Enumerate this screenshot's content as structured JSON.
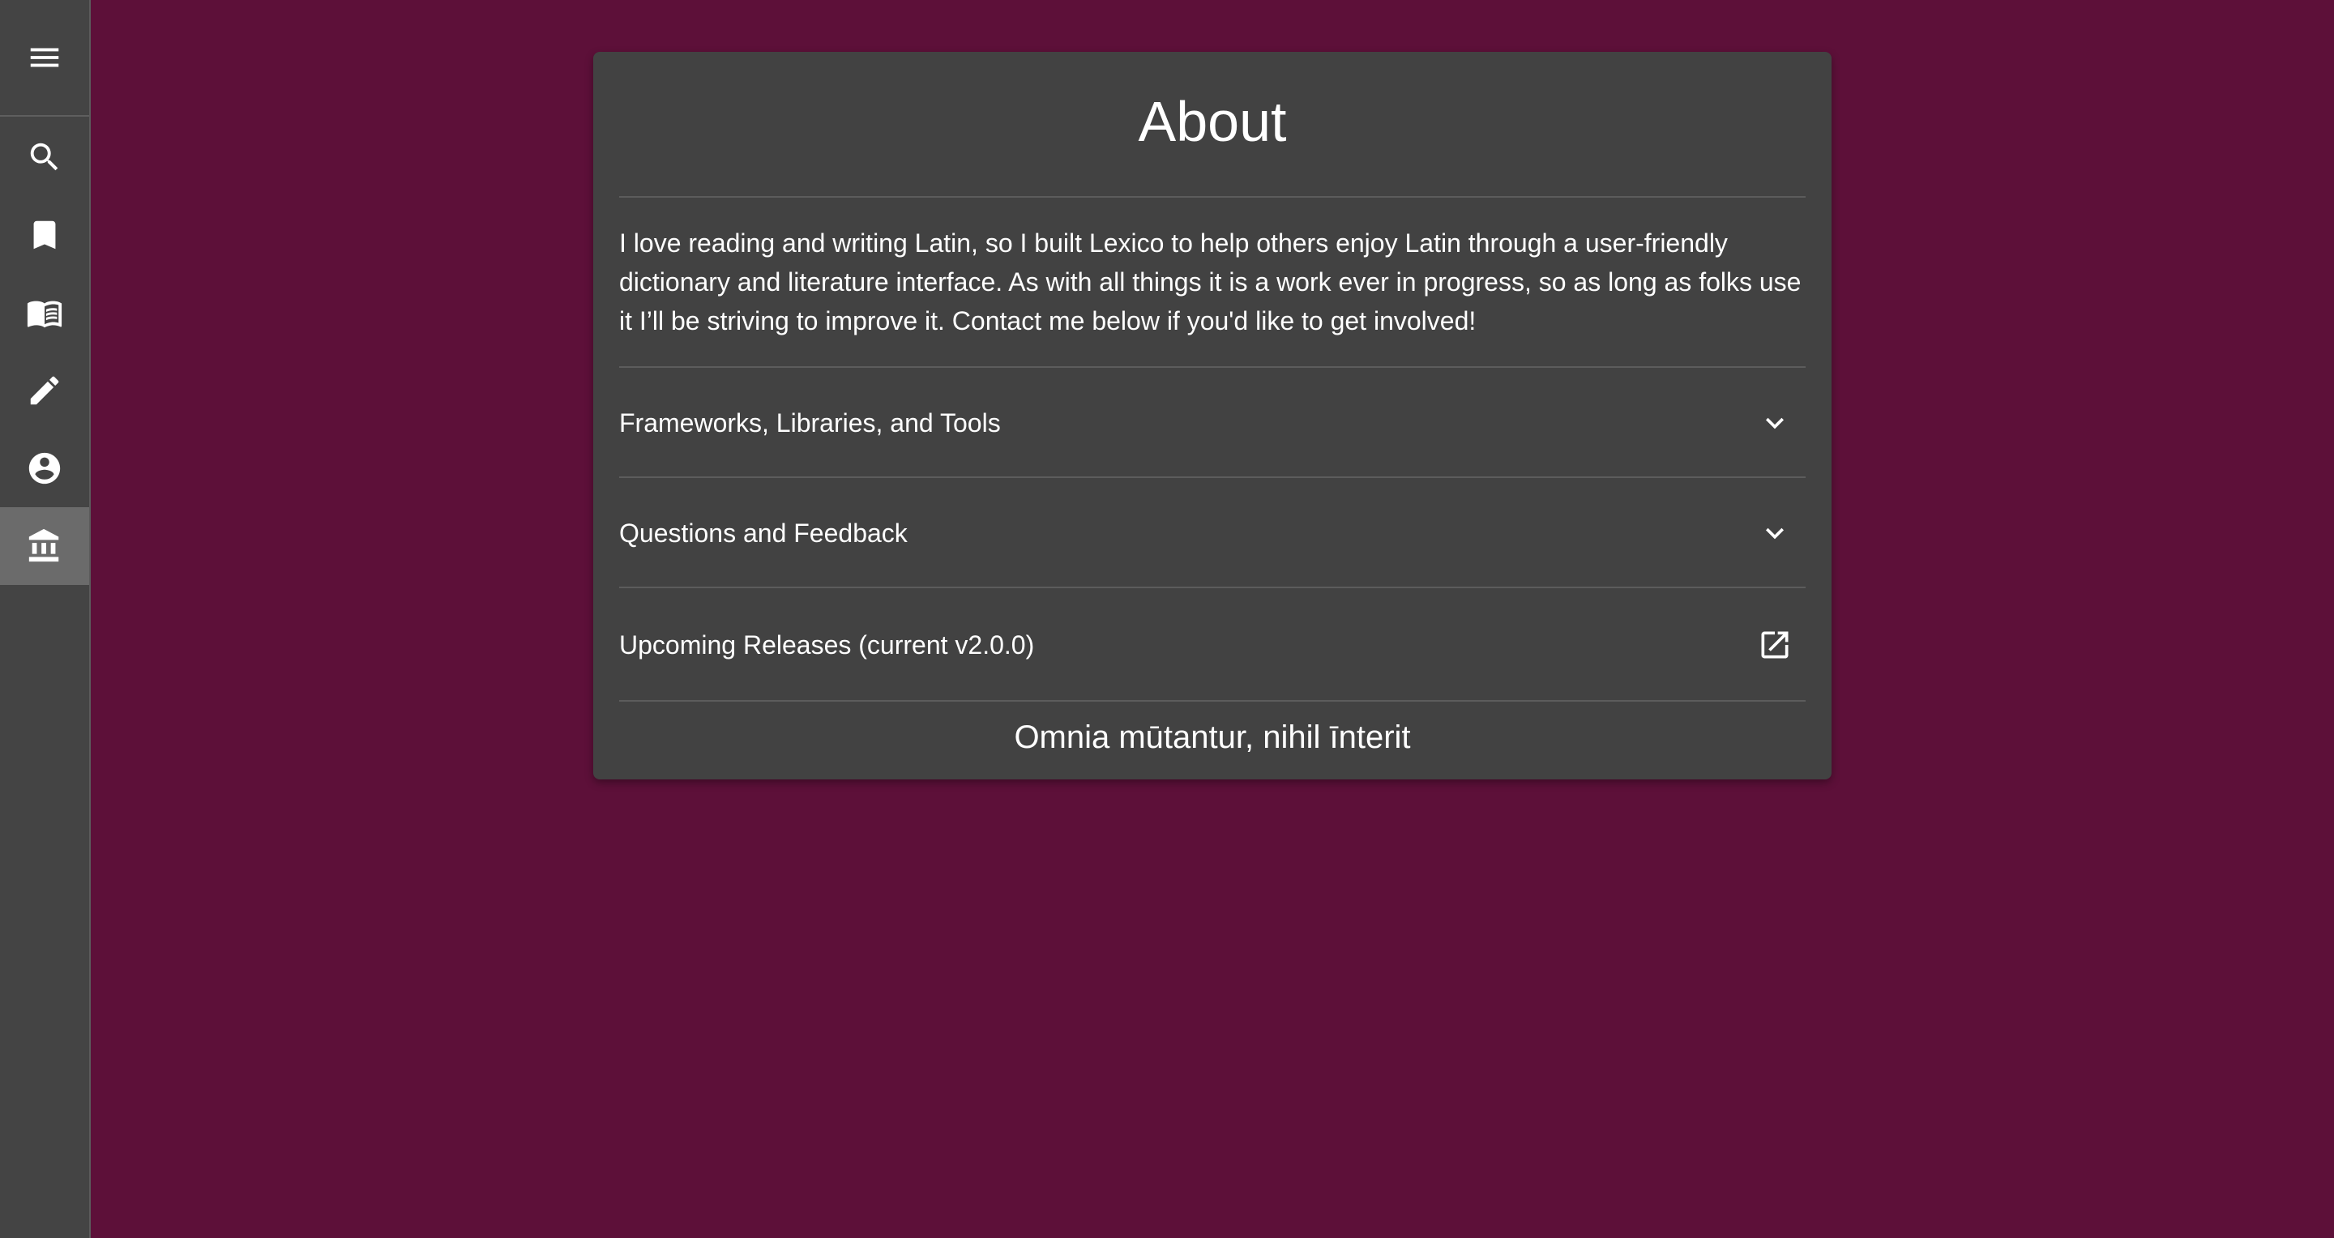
{
  "sidebar": {
    "menu_icon": "menu-icon",
    "items": [
      {
        "name": "search",
        "icon": "search-icon",
        "active": false
      },
      {
        "name": "bookmarks",
        "icon": "bookmark-icon",
        "active": false
      },
      {
        "name": "library",
        "icon": "book-icon",
        "active": false
      },
      {
        "name": "edit",
        "icon": "pencil-icon",
        "active": false
      },
      {
        "name": "account",
        "icon": "account-circle-icon",
        "active": false
      },
      {
        "name": "about",
        "icon": "institution-icon",
        "active": true
      }
    ]
  },
  "about": {
    "title": "About",
    "intro": "I love reading and writing Latin, so I built Lexico to help others enjoy Latin through a user-friendly dictionary and literature interface. As with all things it is a work ever in progress, so as long as folks use it I’ll be striving to improve it. Contact me below if you'd like to get involved!",
    "sections": [
      {
        "label": "Frameworks, Libraries, and Tools",
        "icon": "chevron-down-icon"
      },
      {
        "label": "Questions and Feedback",
        "icon": "chevron-down-icon"
      },
      {
        "label": "Upcoming Releases (current v2.0.0)",
        "icon": "open-in-new-icon"
      }
    ],
    "motto": "Omnia mūtantur, nihil īnterit"
  },
  "colors": {
    "background": "#5d1039",
    "sidebar": "#444444",
    "sidebar_active": "#6b6b6b",
    "card": "#424242",
    "text": "#ffffff"
  }
}
